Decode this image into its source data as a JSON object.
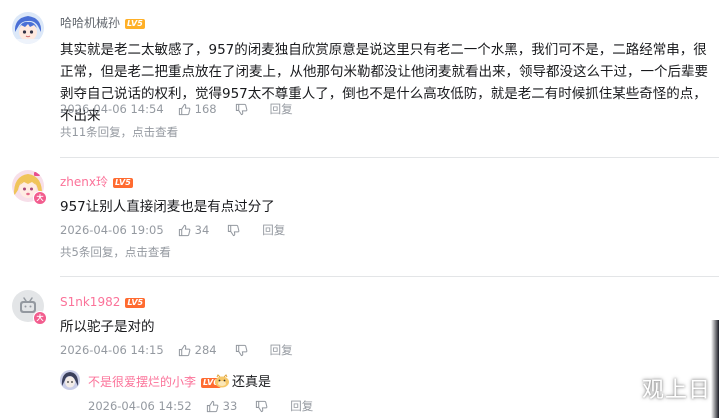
{
  "comments": [
    {
      "username": "哈哈机械孙",
      "level": "LV5",
      "text": "其实就是老二太敏感了，957的闭麦独自欣赏原意是说这里只有老二一个水黑，我们可不是，二路经常串，很正常，但是老二把重点放在了闭麦上，从他那句米勒都没让他闭麦就看出来，领导都没这么干过，一个后辈要剥夺自己说话的权利，觉得957太不尊重人了，倒也不是什么高攻低防，就是老二有时候抓住某些奇怪的点，不出来",
      "date": "2026-04-06 14:54",
      "likes": "168",
      "reply_label": "回复",
      "replies_count": "共11条回复，",
      "view_more": "点击查看"
    },
    {
      "username": "zhenx玲",
      "level": "LV5",
      "text": "957让别人直接闭麦也是有点过分了",
      "date": "2026-04-06 19:05",
      "likes": "34",
      "reply_label": "回复",
      "replies_count": "共5条回复，",
      "view_more": "点击查看"
    },
    {
      "username": "S1nk1982",
      "level": "LV5",
      "text": "所以驼子是对的",
      "date": "2026-04-06 14:15",
      "likes": "284",
      "reply_label": "回复",
      "sub_reply": {
        "username": "不是很爱摆烂的小李",
        "level": "LV6",
        "text": "还真是",
        "date": "2026-04-06 14:52",
        "likes": "33",
        "reply_label": "回复"
      }
    }
  ],
  "watermark": "观上日"
}
